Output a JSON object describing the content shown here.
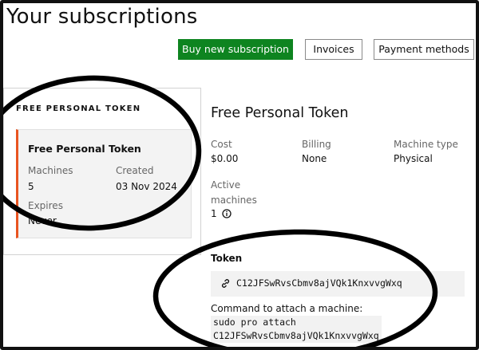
{
  "page": {
    "title": "Your subscriptions"
  },
  "actions": {
    "buy_label": "Buy new subscription",
    "invoices_label": "Invoices",
    "payment_methods_label": "Payment methods"
  },
  "sidebar": {
    "heading": "FREE PERSONAL TOKEN",
    "card": {
      "title": "Free Personal Token",
      "machines_label": "Machines",
      "machines_value": "5",
      "created_label": "Created",
      "created_value": "03 Nov 2024",
      "expires_label": "Expires",
      "expires_value": "Never"
    }
  },
  "details": {
    "title": "Free Personal Token",
    "cost_label": "Cost",
    "cost_value": "$0.00",
    "billing_label": "Billing",
    "billing_value": "None",
    "machine_type_label": "Machine type",
    "machine_type_value": "Physical",
    "active_machines_label": "Active machines",
    "active_machines_value": "1",
    "token_label": "Token",
    "token_value": "C12JFSwRvsCbmv8ajVQk1KnxvvgWxq",
    "command_label": "Command to attach a machine:",
    "command_value": "sudo pro attach\nC12JFSwRvsCbmv8ajVQk1KnxvvgWxq"
  },
  "icons": {
    "token_link": "link-icon",
    "active_machines_info": "info-icon"
  },
  "colors": {
    "primary_button": "#0e8420",
    "card_accent": "#e95420",
    "annotation_ink": "#000000"
  }
}
